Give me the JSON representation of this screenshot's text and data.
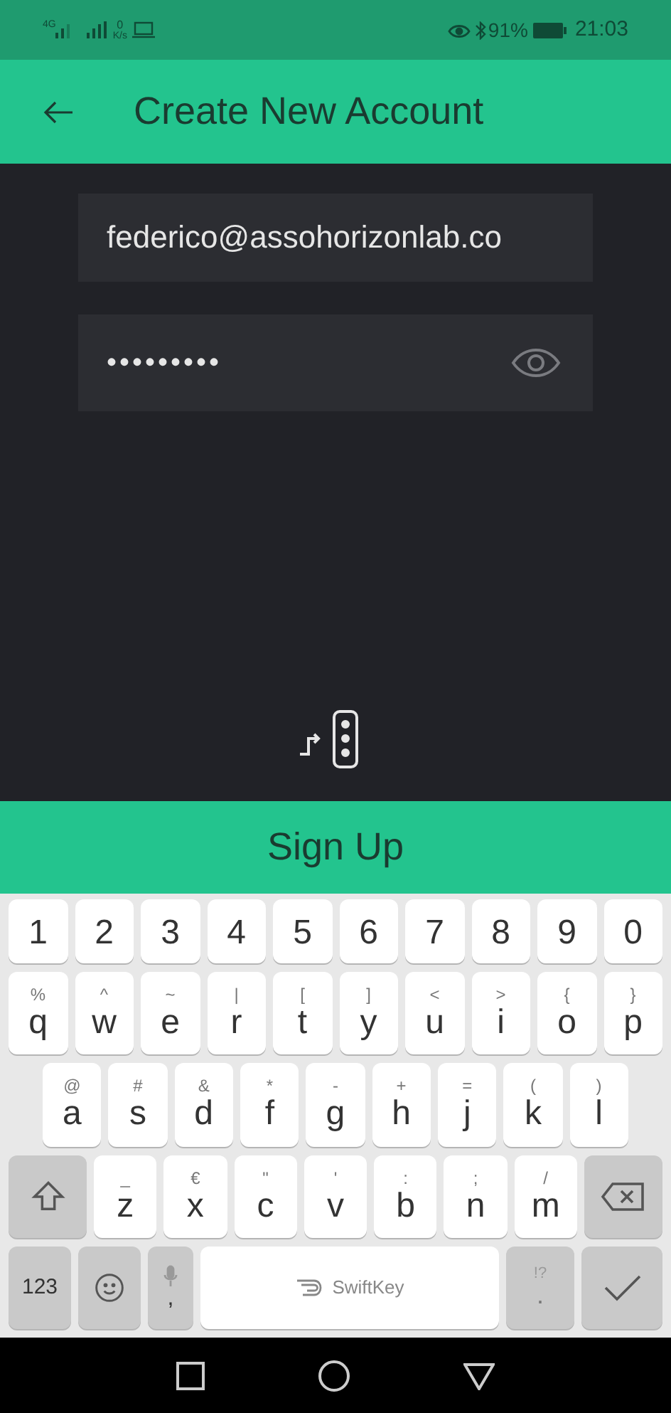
{
  "status_bar": {
    "network": "4G",
    "speed_value": "0",
    "speed_unit": "K/s",
    "battery": "91%",
    "time": "21:03"
  },
  "app_bar": {
    "title": "Create New Account"
  },
  "form": {
    "email": {
      "value": "federico@assohorizonlab.co"
    },
    "password": {
      "value": "•••••••••"
    }
  },
  "sign_up_button": "Sign Up",
  "keyboard": {
    "rows": [
      {
        "keys": [
          {
            "kind": "char",
            "label": "1"
          },
          {
            "kind": "char",
            "label": "2"
          },
          {
            "kind": "char",
            "label": "3"
          },
          {
            "kind": "char",
            "label": "4"
          },
          {
            "kind": "char",
            "label": "5"
          },
          {
            "kind": "char",
            "label": "6"
          },
          {
            "kind": "char",
            "label": "7"
          },
          {
            "kind": "char",
            "label": "8"
          },
          {
            "kind": "char",
            "label": "9"
          },
          {
            "kind": "char",
            "label": "0"
          }
        ]
      },
      {
        "keys": [
          {
            "kind": "char",
            "label": "q",
            "hint": "%"
          },
          {
            "kind": "char",
            "label": "w",
            "hint": "^"
          },
          {
            "kind": "char",
            "label": "e",
            "hint": "~"
          },
          {
            "kind": "char",
            "label": "r",
            "hint": "|"
          },
          {
            "kind": "char",
            "label": "t",
            "hint": "["
          },
          {
            "kind": "char",
            "label": "y",
            "hint": "]"
          },
          {
            "kind": "char",
            "label": "u",
            "hint": "<"
          },
          {
            "kind": "char",
            "label": "i",
            "hint": ">"
          },
          {
            "kind": "char",
            "label": "o",
            "hint": "{"
          },
          {
            "kind": "char",
            "label": "p",
            "hint": "}"
          }
        ]
      },
      {
        "keys": [
          {
            "kind": "char",
            "label": "a",
            "hint": "@"
          },
          {
            "kind": "char",
            "label": "s",
            "hint": "#"
          },
          {
            "kind": "char",
            "label": "d",
            "hint": "&"
          },
          {
            "kind": "char",
            "label": "f",
            "hint": "*"
          },
          {
            "kind": "char",
            "label": "g",
            "hint": "-"
          },
          {
            "kind": "char",
            "label": "h",
            "hint": "+"
          },
          {
            "kind": "char",
            "label": "j",
            "hint": "="
          },
          {
            "kind": "char",
            "label": "k",
            "hint": "("
          },
          {
            "kind": "char",
            "label": "l",
            "hint": ")"
          }
        ]
      },
      {
        "keys": [
          {
            "kind": "shift"
          },
          {
            "kind": "char",
            "label": "z",
            "hint": "_"
          },
          {
            "kind": "char",
            "label": "x",
            "hint": "€"
          },
          {
            "kind": "char",
            "label": "c",
            "hint": "\""
          },
          {
            "kind": "char",
            "label": "v",
            "hint": "'"
          },
          {
            "kind": "char",
            "label": "b",
            "hint": ":"
          },
          {
            "kind": "char",
            "label": "n",
            "hint": ";"
          },
          {
            "kind": "char",
            "label": "m",
            "hint": "/"
          },
          {
            "kind": "backspace"
          }
        ]
      },
      {
        "keys": [
          {
            "kind": "symbols",
            "label": "123"
          },
          {
            "kind": "emoji"
          },
          {
            "kind": "mic",
            "label": ","
          },
          {
            "kind": "space",
            "label": "SwiftKey"
          },
          {
            "kind": "punct",
            "label": ".",
            "hint": "!?"
          },
          {
            "kind": "enter"
          }
        ]
      }
    ]
  }
}
